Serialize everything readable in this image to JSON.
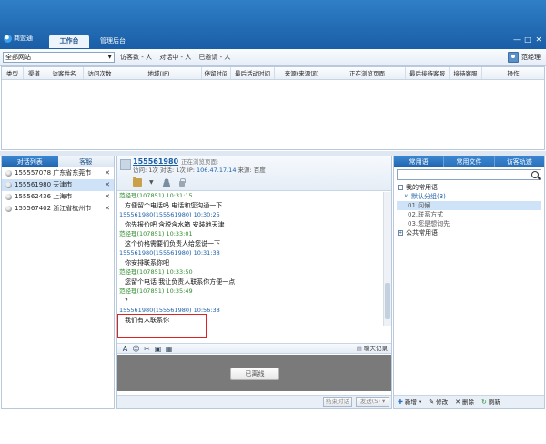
{
  "app": {
    "logo_text": "商盟通",
    "tabs": [
      "工作台",
      "管理后台"
    ],
    "window_controls": {
      "minimize": "—",
      "maximize": "□",
      "close": "✕"
    }
  },
  "toolbar": {
    "site_select": "全部网站",
    "stats": [
      "访客数 - 人",
      "对话中 - 人",
      "已邀请 - 人"
    ],
    "user_name": "范经理"
  },
  "visitor_table": {
    "columns": [
      "类型",
      "渠道",
      "访客姓名",
      "访问次数",
      "地域(IP)",
      "停留时间",
      "最后活动时间",
      "来源(来源词)",
      "正在浏览页面",
      "最后接待客服",
      "接待客服",
      "操作"
    ]
  },
  "left_panel": {
    "tabs": [
      "对话列表",
      "客服"
    ],
    "visitors": [
      {
        "label": "155557078 广东省东莞市",
        "selected": false
      },
      {
        "label": "155561980 天津市",
        "selected": true
      },
      {
        "label": "155562436 上海市",
        "selected": false
      },
      {
        "label": "155567402 浙江省杭州市",
        "selected": false
      }
    ]
  },
  "chat": {
    "visitor_id": "155561980",
    "browsing_label": "正在浏览页面:",
    "meta": {
      "visit_label": "访问: 1次 对话: 1次 IP:",
      "ip": "106.47.17.14",
      "source": "来源: 百度"
    },
    "messages": [
      {
        "from": "agent",
        "header": "范经理(107851)  10:31:15",
        "body": "方便留个电话吗 电话和您沟通一下"
      },
      {
        "from": "visitor",
        "header": "155561980(155561980)  10:30:25",
        "body": "你先报价吧 含税含水箱 安装地天津"
      },
      {
        "from": "agent",
        "header": "范经理(107851)  10:33:01",
        "body": "这个价格需要们负责人给您说一下"
      },
      {
        "from": "visitor",
        "header": "155561980(155561980)  10:31:38",
        "body": "你安排联系你吧"
      },
      {
        "from": "agent",
        "header": "范经理(107851)  10:33:50",
        "body": "您留个电话 我让负责人联系你方便一点"
      },
      {
        "from": "agent",
        "header": "范经理(107851)  10:35:49",
        "body": "?"
      },
      {
        "from": "visitor",
        "header": "155561980(155561980)  10:56:38",
        "body": "我们有人联系你"
      }
    ],
    "input_tools": [
      "A",
      "☺",
      "✂",
      "▣",
      "▦"
    ],
    "history_label": "聊天记录",
    "offline_button": "已离线",
    "end_button": "结束对话",
    "send_button": "发送(S) ▾"
  },
  "right_panel": {
    "tabs": [
      "常用语",
      "常用文件",
      "访客轨迹"
    ],
    "search_placeholder": "",
    "tree": {
      "my_phrases": "我的常用语",
      "default_group": "默认分组(3)",
      "items": [
        "01.问候",
        "02.联系方式",
        "03.您是想询先"
      ],
      "public_phrases": "公共常用语"
    },
    "actions": [
      "新增 ▾",
      "修改",
      "删除",
      "刷新"
    ]
  }
}
